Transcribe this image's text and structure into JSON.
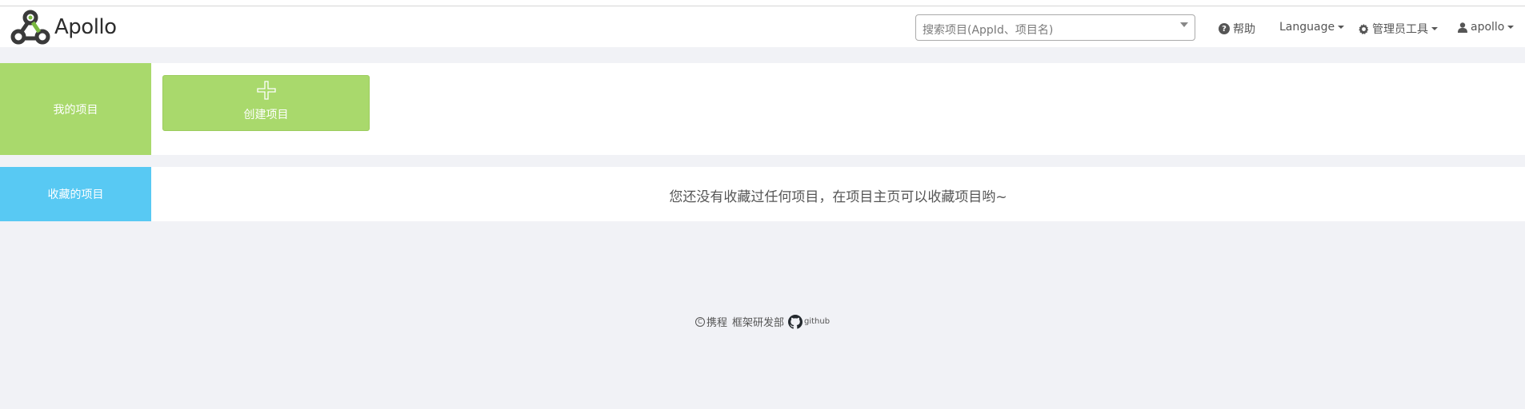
{
  "brand": {
    "name": "Apollo"
  },
  "search": {
    "placeholder": "搜索项目(AppId、项目名)"
  },
  "nav": {
    "help": "帮助",
    "language": "Language",
    "admin_tools": "管理员工具",
    "user": "apollo"
  },
  "my_projects": {
    "label": "我的项目",
    "create_label": "创建项目"
  },
  "favorites": {
    "label": "收藏的项目",
    "empty_message": "您还没有收藏过任何项目，在项目主页可以收藏项目哟~"
  },
  "footer": {
    "company": "携程",
    "department": "框架研发部",
    "github": "github"
  },
  "colors": {
    "accent_green": "#a9d96c",
    "accent_blue": "#58c9f3",
    "background": "#f1f2f6"
  }
}
